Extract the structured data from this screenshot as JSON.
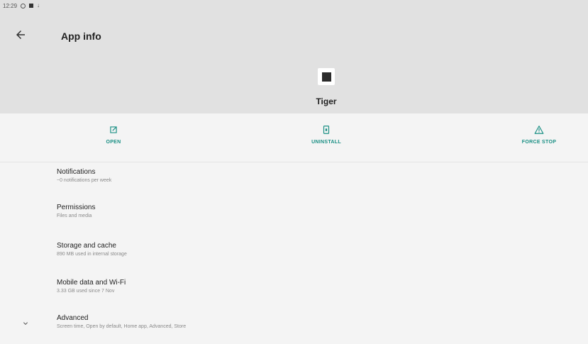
{
  "status_bar": {
    "time": "12:29"
  },
  "app_bar": {
    "title": "App info"
  },
  "app": {
    "name": "Tiger"
  },
  "actions": [
    {
      "label": "OPEN",
      "icon": "open-in-new-icon"
    },
    {
      "label": "UNINSTALL",
      "icon": "uninstall-icon"
    },
    {
      "label": "FORCE STOP",
      "icon": "warning-icon"
    }
  ],
  "settings": [
    {
      "title": "Notifications",
      "subtitle": "~0 notifications per week"
    },
    {
      "title": "Permissions",
      "subtitle": "Files and media"
    },
    {
      "title": "Storage and cache",
      "subtitle": "890 MB used in internal storage"
    },
    {
      "title": "Mobile data and Wi-Fi",
      "subtitle": "3.33 GB used since 7 Nov"
    },
    {
      "title": "Advanced",
      "subtitle": "Screen time, Open by default, Home app, Advanced, Store"
    }
  ],
  "colors": {
    "accent": "#1a8f84",
    "header_bg": "#e1e1e1",
    "page_bg": "#f4f4f4"
  }
}
